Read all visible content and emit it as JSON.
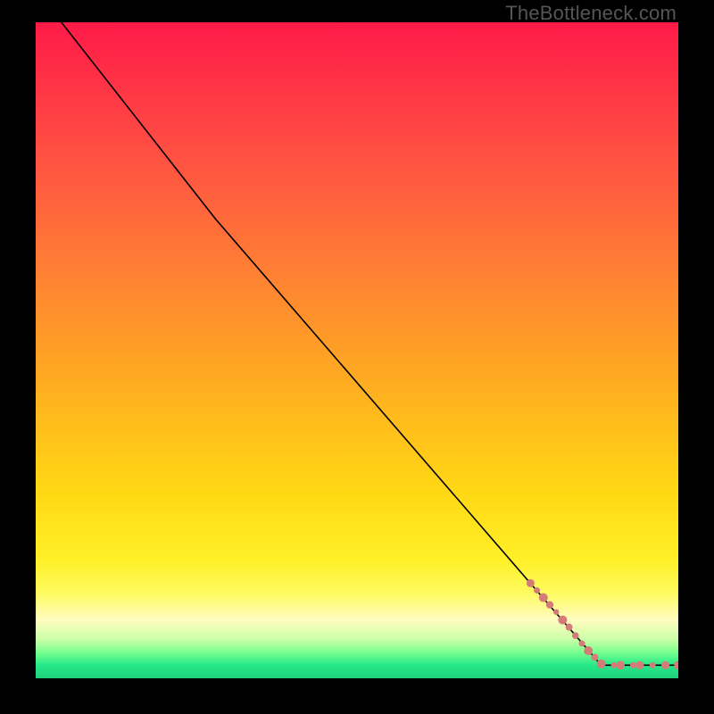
{
  "watermark": "TheBottleneck.com",
  "chart_data": {
    "type": "line",
    "title": "",
    "xlabel": "",
    "ylabel": "",
    "xlim": [
      0,
      100
    ],
    "ylim": [
      0,
      100
    ],
    "grid": false,
    "legend": false,
    "series": [
      {
        "name": "curve",
        "x": [
          4,
          28,
          88,
          100
        ],
        "y": [
          100,
          70,
          2,
          2
        ],
        "stroke": "#000000",
        "stroke_width": 1.6
      }
    ],
    "markers": {
      "name": "end-markers",
      "color": "#d47c78",
      "points": [
        {
          "x": 77,
          "y": 14.5,
          "r": 4.5
        },
        {
          "x": 78,
          "y": 13.4,
          "r": 3.5
        },
        {
          "x": 79,
          "y": 12.3,
          "r": 5.0
        },
        {
          "x": 80,
          "y": 11.2,
          "r": 4.2
        },
        {
          "x": 81,
          "y": 10.1,
          "r": 3.2
        },
        {
          "x": 82,
          "y": 8.9,
          "r": 5.0
        },
        {
          "x": 83,
          "y": 7.8,
          "r": 4.0
        },
        {
          "x": 84,
          "y": 6.5,
          "r": 3.8
        },
        {
          "x": 85,
          "y": 5.3,
          "r": 3.5
        },
        {
          "x": 86,
          "y": 4.2,
          "r": 5.0
        },
        {
          "x": 87,
          "y": 3.2,
          "r": 4.0
        },
        {
          "x": 88,
          "y": 2.2,
          "r": 5.0
        },
        {
          "x": 90,
          "y": 2.0,
          "r": 3.4
        },
        {
          "x": 91,
          "y": 2.0,
          "r": 4.8
        },
        {
          "x": 93,
          "y": 2.0,
          "r": 3.6
        },
        {
          "x": 94,
          "y": 2.0,
          "r": 4.6
        },
        {
          "x": 96,
          "y": 2.0,
          "r": 3.4
        },
        {
          "x": 98,
          "y": 2.0,
          "r": 4.6
        },
        {
          "x": 100,
          "y": 2.0,
          "r": 4.8
        }
      ]
    }
  }
}
